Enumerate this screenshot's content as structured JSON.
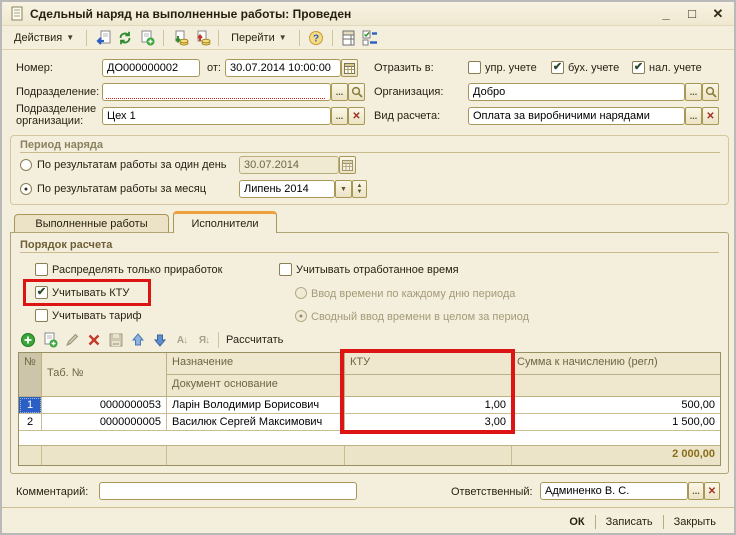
{
  "colors": {
    "window_bg": "#f4efdd",
    "border_gold": "#a89858",
    "annotation_red": "#dd1414",
    "selection_blue": "#2b5fc4",
    "total_text": "#8a6d1b",
    "tab_accent_orange": "#eda13b"
  },
  "window": {
    "title": "Сдельный наряд на выполненные работы: Проведен"
  },
  "glyphs": {
    "dropdown": "▾",
    "combo_arrow": "▼",
    "spin_up": "▲",
    "spin_down": "▼",
    "ellipsis": "...",
    "clear": "✕",
    "minimize": "_",
    "maximize": "□",
    "close": "✕"
  },
  "main_toolbar": {
    "actions_label": "Действия",
    "goto_label": "Перейти"
  },
  "header_fields": {
    "number_label": "Номер:",
    "number_value": "ДО000000002",
    "date_label": "от:",
    "date_value": "30.07.2014 10:00:00",
    "department_label": "Подразделение:",
    "department_value": "",
    "org_department_label": "Подразделение организации:",
    "org_department_value": "Цех 1",
    "reflect_label": "Отразить в:",
    "reflect_options": [
      {
        "label": "упр. учете",
        "mark": ""
      },
      {
        "label": "бух. учете",
        "mark": "✔"
      },
      {
        "label": "нал. учете",
        "mark": "✔"
      }
    ],
    "organization_label": "Организация:",
    "organization_value": "Добро",
    "calc_kind_label": "Вид расчета:",
    "calc_kind_value": "Оплата за виробничими нарядами"
  },
  "period_group": {
    "title": "Период наряда",
    "day_option": {
      "label": "По результатам работы за один день",
      "mark": "",
      "value": "30.07.2014"
    },
    "month_option": {
      "label": "По результатам работы за месяц",
      "mark": "●",
      "value": "Липень 2014"
    }
  },
  "tabs": [
    {
      "label": "Выполненные работы"
    },
    {
      "label": "Исполнители"
    }
  ],
  "calc_order": {
    "title": "Порядок расчета",
    "left_checkboxes": [
      {
        "label": "Распределять только приработок",
        "mark": ""
      },
      {
        "label": "Учитывать КТУ",
        "mark": "✔"
      },
      {
        "label": "Учитывать тариф",
        "mark": ""
      }
    ],
    "time_checkbox": {
      "label": "Учитывать отработанное время",
      "mark": ""
    },
    "time_radios": [
      {
        "label": "Ввод времени по каждому дню периода",
        "mark": ""
      },
      {
        "label": "Сводный ввод времени в целом за период",
        "mark": "●"
      }
    ]
  },
  "grid": {
    "toolbar": {
      "calculate_label": "Рассчитать",
      "sort_asc": "А↓",
      "sort_desc": "Я↓"
    },
    "headers": {
      "num": "№",
      "tab_num": "Таб. №",
      "purpose": "Назначение",
      "doc_base": "Документ основание",
      "ktu": "КТУ",
      "sum": "Сумма к начислению (регл)"
    },
    "rows": [
      {
        "num": "1",
        "tab_num": "0000000053",
        "name": "Ларін Володимир Борисович",
        "ktu": "1,00",
        "sum": "500,00"
      },
      {
        "num": "2",
        "tab_num": "0000000005",
        "name": "Василюк Сергей Максимович",
        "ktu": "3,00",
        "sum": "1 500,00"
      }
    ],
    "total_sum": "2 000,00"
  },
  "footer": {
    "comment_label": "Комментарий:",
    "comment_value": "",
    "responsible_label": "Ответственный:",
    "responsible_value": "Админенко В. С.",
    "ok_label": "ОК",
    "save_label": "Записать",
    "close_label": "Закрыть"
  }
}
